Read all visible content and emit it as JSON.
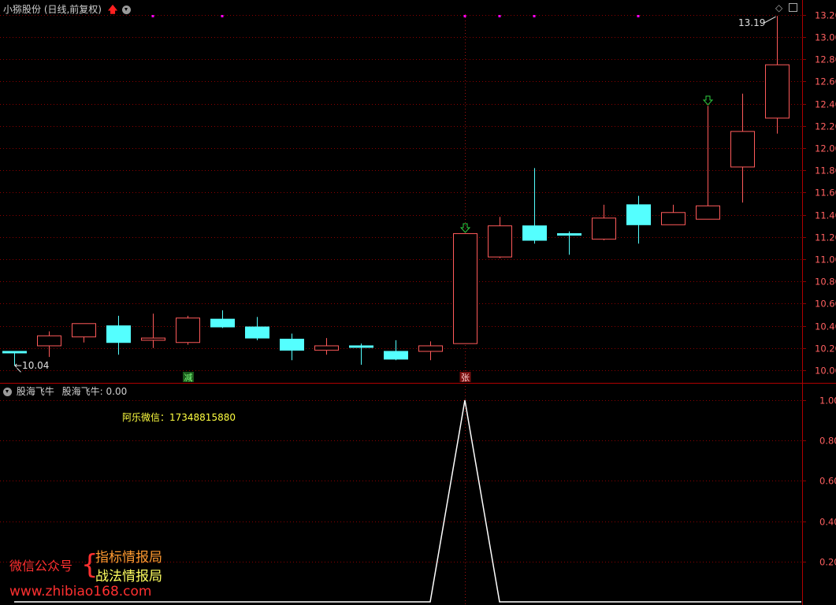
{
  "header": {
    "title": "小猕股份 (日线,前复权)",
    "indicator_name": "股海飞牛",
    "indicator_value_text": "股海飞牛: 0.00"
  },
  "annotation": {
    "contact": "阿乐微信：17348815880"
  },
  "markers": {
    "high_label": "13.19",
    "low_label": "10.04",
    "down_text": "减",
    "up_text": "张"
  },
  "watermark": {
    "line1_left": "微信公众号",
    "line1_right": "指标情报局",
    "line2_right": "战法情报局",
    "url": "www.zhibiao168.com"
  },
  "colors": {
    "up": "#ff5a5a",
    "down": "#54ffff",
    "grid": "#8b0000",
    "axis_text": "#ff6060",
    "indicator_line": "#ffffff",
    "dot": "#ff00ff",
    "marker_arrow": "#2ecc40"
  },
  "chart_data": [
    {
      "type": "candlestick",
      "title": "小猕股份 (日线,前复权)",
      "ylim": [
        9.92,
        13.3
      ],
      "y_ticks": [
        10.0,
        10.2,
        10.4,
        10.6,
        10.8,
        11.0,
        11.2,
        11.4,
        11.6,
        11.8,
        12.0,
        12.2,
        12.4,
        12.6,
        12.8,
        13.0,
        13.2
      ],
      "candles": [
        {
          "open": 10.17,
          "high": 10.17,
          "low": 10.04,
          "close": 10.17
        },
        {
          "open": 10.22,
          "high": 10.35,
          "low": 10.12,
          "close": 10.31
        },
        {
          "open": 10.3,
          "high": 10.42,
          "low": 10.25,
          "close": 10.42
        },
        {
          "open": 10.4,
          "high": 10.49,
          "low": 10.14,
          "close": 10.25
        },
        {
          "open": 10.27,
          "high": 10.51,
          "low": 10.2,
          "close": 10.29
        },
        {
          "open": 10.25,
          "high": 10.49,
          "low": 10.23,
          "close": 10.47
        },
        {
          "open": 10.46,
          "high": 10.54,
          "low": 10.38,
          "close": 10.39
        },
        {
          "open": 10.39,
          "high": 10.48,
          "low": 10.27,
          "close": 10.29
        },
        {
          "open": 10.28,
          "high": 10.33,
          "low": 10.09,
          "close": 10.18
        },
        {
          "open": 10.18,
          "high": 10.29,
          "low": 10.14,
          "close": 10.22
        },
        {
          "open": 10.22,
          "high": 10.24,
          "low": 10.05,
          "close": 10.22
        },
        {
          "open": 10.17,
          "high": 10.27,
          "low": 10.09,
          "close": 10.1
        },
        {
          "open": 10.17,
          "high": 10.26,
          "low": 10.09,
          "close": 10.22
        },
        {
          "open": 10.24,
          "high": 11.23,
          "low": 10.24,
          "close": 11.23
        },
        {
          "open": 11.02,
          "high": 11.38,
          "low": 11.01,
          "close": 11.3
        },
        {
          "open": 11.3,
          "high": 11.82,
          "low": 11.14,
          "close": 11.17
        },
        {
          "open": 11.23,
          "high": 11.25,
          "low": 11.04,
          "close": 11.22
        },
        {
          "open": 11.18,
          "high": 11.49,
          "low": 11.17,
          "close": 11.37
        },
        {
          "open": 11.49,
          "high": 11.57,
          "low": 11.14,
          "close": 11.31
        },
        {
          "open": 11.31,
          "high": 11.49,
          "low": 11.31,
          "close": 11.42
        },
        {
          "open": 11.36,
          "high": 12.38,
          "low": 11.36,
          "close": 11.48
        },
        {
          "open": 11.83,
          "high": 12.49,
          "low": 11.51,
          "close": 12.15
        },
        {
          "open": 12.27,
          "high": 13.19,
          "low": 12.13,
          "close": 12.75
        }
      ]
    },
    {
      "type": "line",
      "title": "股海飞牛",
      "ylim": [
        0.0,
        1.0
      ],
      "y_ticks": [
        0.2,
        0.4,
        0.6,
        0.8,
        1.0
      ],
      "values": [
        0,
        0,
        0,
        0,
        0,
        0,
        0,
        0,
        0,
        0,
        0,
        0,
        0,
        1,
        0,
        0,
        0,
        0,
        0,
        0,
        0,
        0,
        0
      ]
    }
  ]
}
